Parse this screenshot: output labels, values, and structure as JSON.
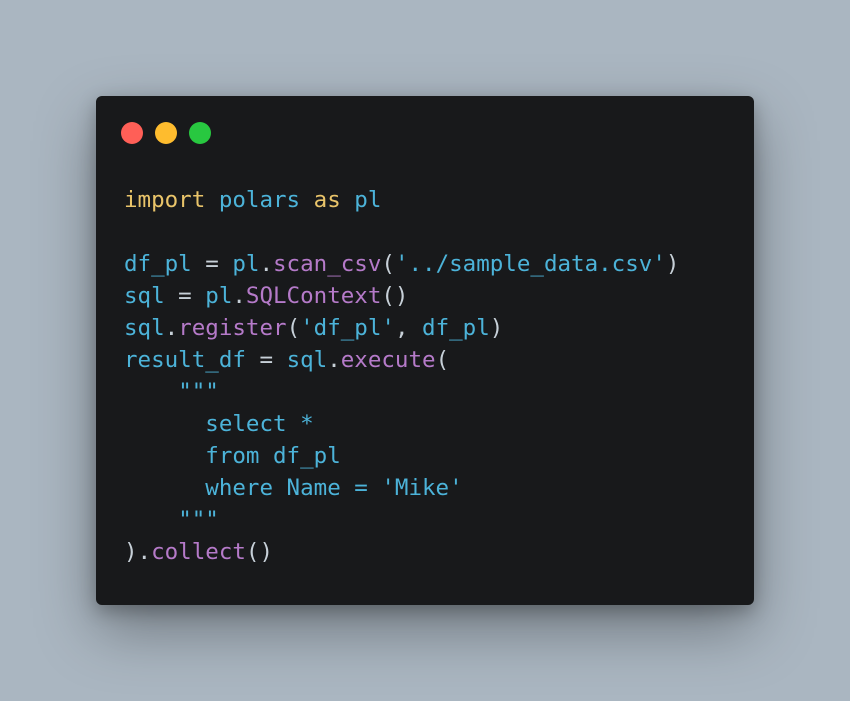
{
  "colors": {
    "background": "#aab6c1",
    "window": "#18191b",
    "close": "#ff5f57",
    "minimize": "#febc2e",
    "zoom": "#28c840",
    "keyword": "#e9c46a",
    "identifier": "#4cb3d9",
    "function": "#b57ac9",
    "punctuation": "#c7d0d8"
  },
  "window_controls": {
    "close": "close-icon",
    "minimize": "minimize-icon",
    "zoom": "zoom-icon"
  },
  "code": {
    "language": "python",
    "lines": [
      [
        {
          "t": "import",
          "c": "kw"
        },
        {
          "t": " ",
          "c": "pu"
        },
        {
          "t": "polars",
          "c": "id"
        },
        {
          "t": " ",
          "c": "pu"
        },
        {
          "t": "as",
          "c": "kw"
        },
        {
          "t": " ",
          "c": "pu"
        },
        {
          "t": "pl",
          "c": "id"
        }
      ],
      [],
      [
        {
          "t": "df_pl",
          "c": "id"
        },
        {
          "t": " = ",
          "c": "op"
        },
        {
          "t": "pl",
          "c": "id"
        },
        {
          "t": ".",
          "c": "pu"
        },
        {
          "t": "scan_csv",
          "c": "fn"
        },
        {
          "t": "(",
          "c": "pu"
        },
        {
          "t": "'../sample_data.csv'",
          "c": "st"
        },
        {
          "t": ")",
          "c": "pu"
        }
      ],
      [
        {
          "t": "sql",
          "c": "id"
        },
        {
          "t": " = ",
          "c": "op"
        },
        {
          "t": "pl",
          "c": "id"
        },
        {
          "t": ".",
          "c": "pu"
        },
        {
          "t": "SQLContext",
          "c": "fn"
        },
        {
          "t": "()",
          "c": "pu"
        }
      ],
      [
        {
          "t": "sql",
          "c": "id"
        },
        {
          "t": ".",
          "c": "pu"
        },
        {
          "t": "register",
          "c": "fn"
        },
        {
          "t": "(",
          "c": "pu"
        },
        {
          "t": "'df_pl'",
          "c": "st"
        },
        {
          "t": ", ",
          "c": "pu"
        },
        {
          "t": "df_pl",
          "c": "id"
        },
        {
          "t": ")",
          "c": "pu"
        }
      ],
      [
        {
          "t": "result_df",
          "c": "id"
        },
        {
          "t": " = ",
          "c": "op"
        },
        {
          "t": "sql",
          "c": "id"
        },
        {
          "t": ".",
          "c": "pu"
        },
        {
          "t": "execute",
          "c": "fn"
        },
        {
          "t": "(",
          "c": "pu"
        }
      ],
      [
        {
          "t": "    ",
          "c": "pu"
        },
        {
          "t": "\"\"\"",
          "c": "st"
        }
      ],
      [
        {
          "t": "      select *",
          "c": "st"
        }
      ],
      [
        {
          "t": "      from df_pl",
          "c": "st"
        }
      ],
      [
        {
          "t": "      where Name = 'Mike'",
          "c": "st"
        }
      ],
      [
        {
          "t": "    ",
          "c": "pu"
        },
        {
          "t": "\"\"\"",
          "c": "st"
        }
      ],
      [
        {
          "t": ").",
          "c": "pu"
        },
        {
          "t": "collect",
          "c": "fn"
        },
        {
          "t": "()",
          "c": "pu"
        }
      ]
    ]
  }
}
